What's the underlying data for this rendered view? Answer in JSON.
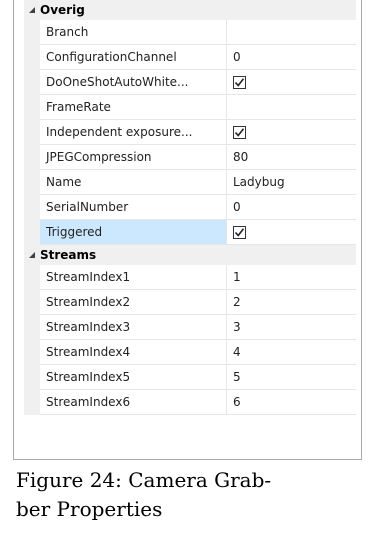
{
  "categories": [
    {
      "title": "Overig",
      "rows": [
        {
          "name": "Branch",
          "value": ""
        },
        {
          "name": "ConfigurationChannel",
          "value": "0"
        },
        {
          "name": "DoOneShotAutoWhite...",
          "checked": true
        },
        {
          "name": "FrameRate",
          "value": ""
        },
        {
          "name": "Independent exposure...",
          "checked": true
        },
        {
          "name": "JPEGCompression",
          "value": "80"
        },
        {
          "name": "Name",
          "value": "Ladybug"
        },
        {
          "name": "SerialNumber",
          "value": "0"
        },
        {
          "name": "Triggered",
          "checked": true,
          "selected": true
        }
      ]
    },
    {
      "title": "Streams",
      "rows": [
        {
          "name": "StreamIndex1",
          "value": "1"
        },
        {
          "name": "StreamIndex2",
          "value": "2"
        },
        {
          "name": "StreamIndex3",
          "value": "3"
        },
        {
          "name": "StreamIndex4",
          "value": "4"
        },
        {
          "name": "StreamIndex5",
          "value": "5"
        },
        {
          "name": "StreamIndex6",
          "value": "6"
        }
      ]
    }
  ],
  "caption": {
    "line1": "Figure 24: Camera Grab-",
    "line2": "ber Properties"
  }
}
